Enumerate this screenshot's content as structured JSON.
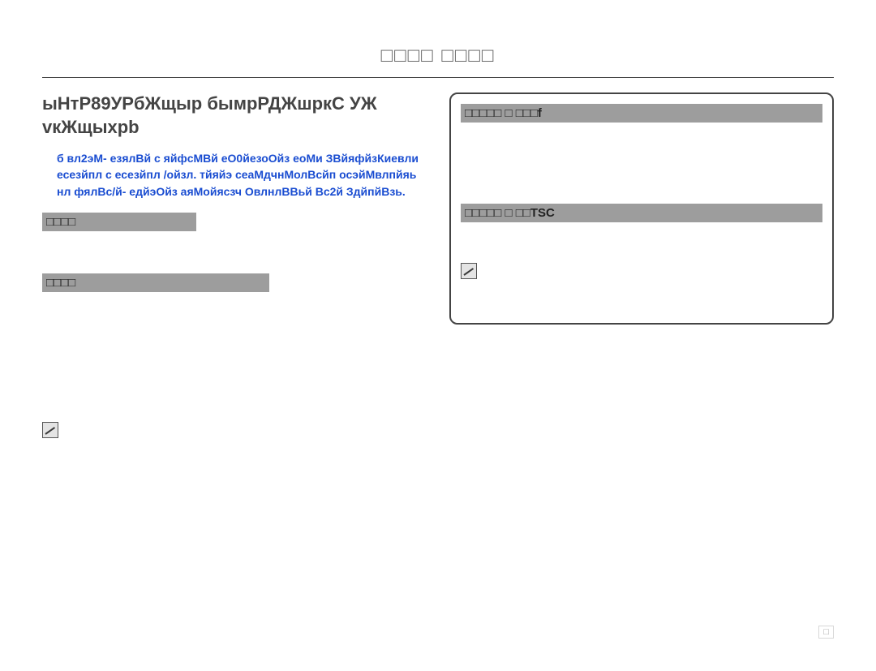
{
  "section_title": "□□□□ □□□□",
  "heading": "ыНтР89УРбЖщыр бымрРДЖшркС УЖ vкЖщыхрb",
  "blue_note": "б вл2эМ- езялВй с яйфсМВй еО0йезоОйз еоМи ЗВйяфйзКиевли есезйпл с есезйпл /ойзл. тйяйэ сеаМдчнМолВсйп осэйМвлпйяь нл фялВс/й- едйэОйз аяМойясзч ОвлнлВВьй Вс2й ЗдйпйВзь.",
  "left": {
    "bar1": "□□□□",
    "p1": "",
    "p2": "",
    "p3": "",
    "bar2": "□□□□",
    "p4": "",
    "note": ""
  },
  "right_panel": {
    "bar1": "□□□□□ □ □□□f",
    "p1": "",
    "p2": "",
    "bar2": "□□□□□ □ □□TSC",
    "p3": "",
    "note": ""
  },
  "page_number": "□"
}
